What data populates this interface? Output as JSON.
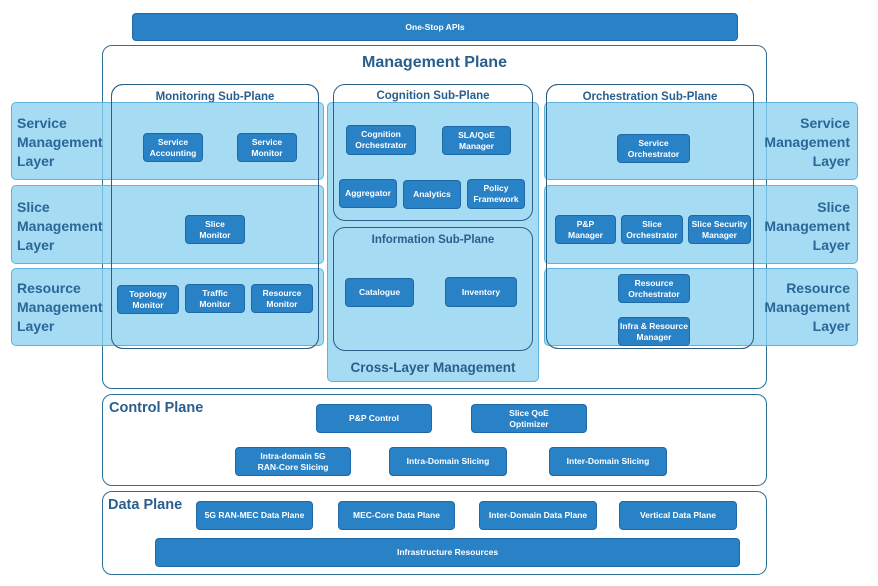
{
  "top_api": "One-Stop APIs",
  "management_plane": {
    "title": "Management Plane",
    "layers": {
      "service_left": "Service\nManagement\nLayer",
      "slice_left": "Slice\nManagement\nLayer",
      "resource_left": "Resource\nManagement\nLayer",
      "service_right": "Service\nManagement\nLayer",
      "slice_right": "Slice\nManagement\nLayer",
      "resource_right": "Resource\nManagement\nLayer"
    },
    "monitoring": {
      "title": "Monitoring Sub-Plane",
      "service_accounting": "Service\nAccounting",
      "service_monitor": "Service\nMonitor",
      "slice_monitor": "Slice\nMonitor",
      "topology_monitor": "Topology\nMonitor",
      "traffic_monitor": "Traffic\nMonitor",
      "resource_monitor": "Resource\nMonitor"
    },
    "cross_layer": {
      "title": "Cross-Layer Management",
      "cognition": {
        "title": "Cognition Sub-Plane",
        "cognition_orchestrator": "Cognition\nOrchestrator",
        "sla_qoe_manager": "SLA/QoE\nManager",
        "aggregator": "Aggregator",
        "analytics": "Analytics",
        "policy_framework": "Policy\nFramework"
      },
      "information": {
        "title": "Information Sub-Plane",
        "catalogue": "Catalogue",
        "inventory": "Inventory"
      }
    },
    "orchestration": {
      "title": "Orchestration Sub-Plane",
      "service_orchestrator": "Service\nOrchestrator",
      "pp_manager": "P&P\nManager",
      "slice_orchestrator": "Slice\nOrchestrator",
      "slice_security_manager": "Slice Security\nManager",
      "resource_orchestrator": "Resource\nOrchestrator",
      "infra_resource_manager": "Infra & Resource\nManager"
    }
  },
  "control_plane": {
    "title": "Control Plane",
    "pp_control": "P&P Control",
    "slice_qoe_optimizer": "Slice QoE\nOptimizer",
    "intra_domain_5g": "Intra-domain 5G\nRAN-Core Slicing",
    "intra_domain_slicing": "Intra-Domain Slicing",
    "inter_domain_slicing": "Inter-Domain Slicing"
  },
  "data_plane": {
    "title": "Data Plane",
    "ran_mec": "5G RAN-MEC Data Plane",
    "mec_core": "MEC-Core Data Plane",
    "inter_domain": "Inter-Domain Data Plane",
    "vertical": "Vertical Data Plane",
    "infrastructure": "Infrastructure Resources"
  },
  "colors": {
    "component_fill": "#2a82c6",
    "layer_band": "#a5dcf2",
    "title_text": "#2a5e8c"
  }
}
